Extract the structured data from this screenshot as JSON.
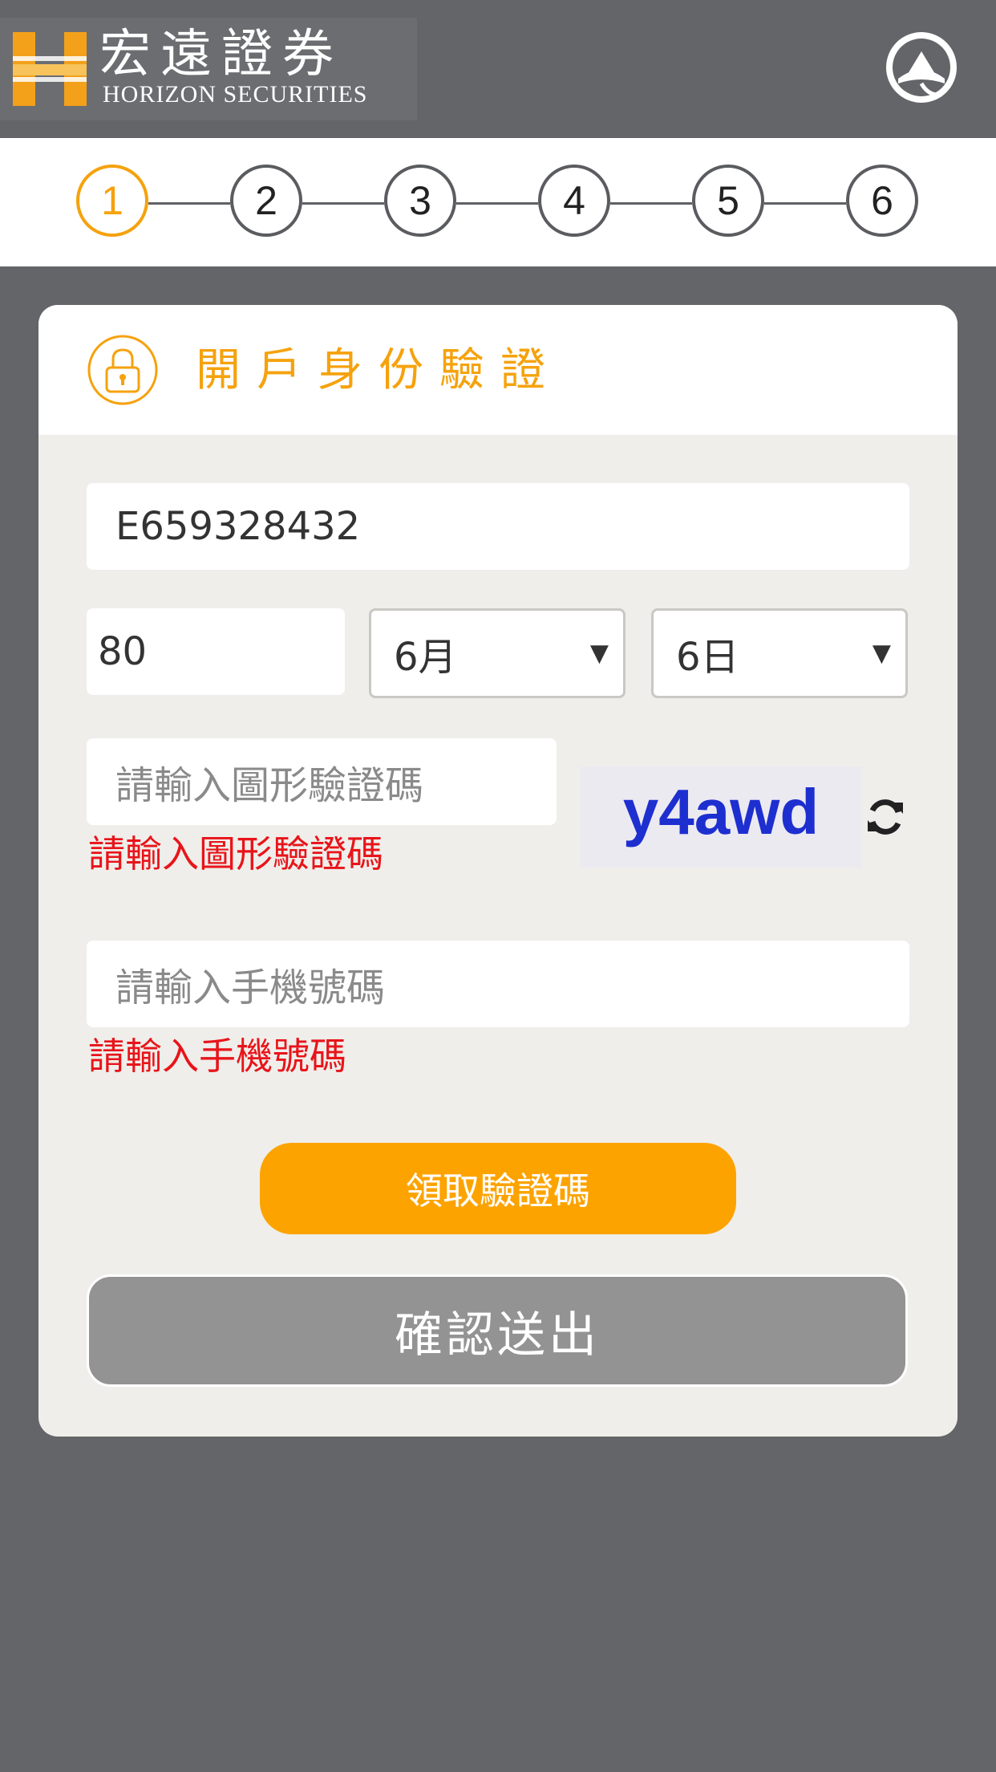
{
  "header": {
    "logo_cn": "宏遠證券",
    "logo_en": "HORIZON SECURITIES"
  },
  "stepper": {
    "steps": [
      "1",
      "2",
      "3",
      "4",
      "5",
      "6"
    ],
    "active_step": 1,
    "colors": {
      "active": "#f5a20e",
      "inactive": "#5a5c60"
    }
  },
  "card": {
    "title": "開戶身份驗證",
    "id_field": {
      "value": "E659328432"
    },
    "birth": {
      "year": "80",
      "month": "6月",
      "day": "6日"
    },
    "captcha": {
      "placeholder": "請輸入圖形驗證碼",
      "error": "請輸入圖形驗證碼",
      "code": "y4awd"
    },
    "phone": {
      "placeholder": "請輸入手機號碼",
      "error": "請輸入手機號碼"
    },
    "get_code_label": "領取驗證碼",
    "submit_label": "確認送出"
  },
  "colors": {
    "accent": "#f5a20e",
    "button_orange": "#fda300",
    "error": "#e8141a",
    "submit_gray": "#939393",
    "background": "#646569"
  },
  "icons": {
    "lock": "lock-icon",
    "refresh": "refresh-icon",
    "profile": "profile-icon",
    "logo": "horizon-logo-icon"
  }
}
